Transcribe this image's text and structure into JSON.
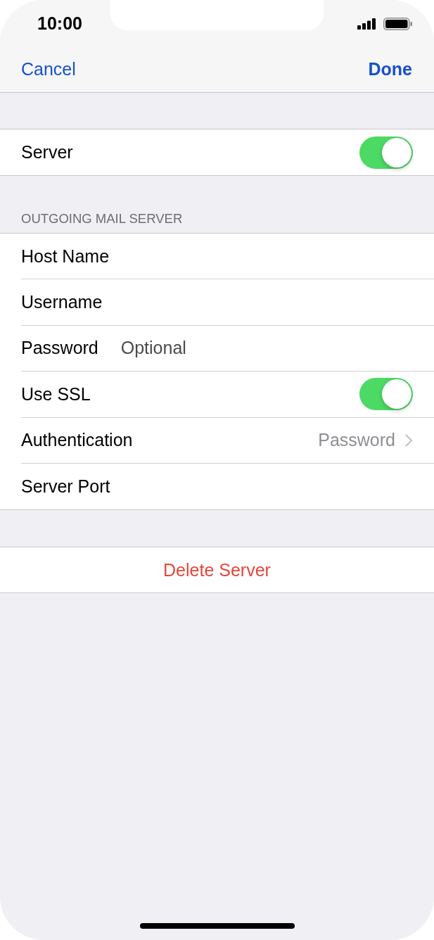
{
  "status_bar": {
    "time": "10:00"
  },
  "nav_bar": {
    "cancel": "Cancel",
    "done": "Done"
  },
  "server": {
    "label": "Server",
    "on": true
  },
  "outgoing_mail_server": {
    "header": "OUTGOING MAIL SERVER",
    "rows": [
      {
        "kind": "text",
        "label": "Host Name"
      },
      {
        "kind": "text",
        "label": "Username"
      },
      {
        "kind": "text",
        "label": "Password",
        "placeholder": "Optional"
      },
      {
        "kind": "toggle",
        "label": "Use SSL",
        "on": true
      },
      {
        "kind": "detail",
        "label": "Authentication",
        "value": "Password"
      },
      {
        "kind": "text",
        "label": "Server Port"
      }
    ]
  },
  "delete_button": "Delete Server"
}
